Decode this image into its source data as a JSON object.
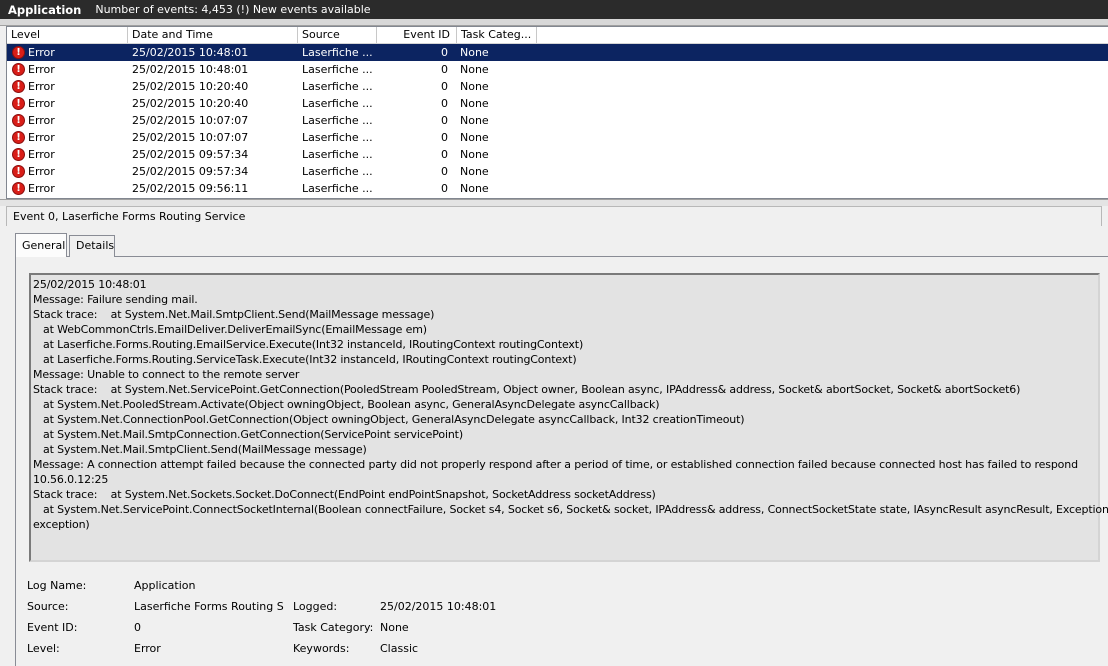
{
  "header": {
    "app_title": "Application",
    "event_count": "Number of events: 4,453 (!) New events available"
  },
  "columns": {
    "level": "Level",
    "datetime": "Date and Time",
    "source": "Source",
    "event_id": "Event ID",
    "task_category": "Task Categ..."
  },
  "events": [
    {
      "level": "Error",
      "datetime": "25/02/2015 10:48:01",
      "source": "Laserfiche ...",
      "event_id": "0",
      "task": "None"
    },
    {
      "level": "Error",
      "datetime": "25/02/2015 10:48:01",
      "source": "Laserfiche ...",
      "event_id": "0",
      "task": "None"
    },
    {
      "level": "Error",
      "datetime": "25/02/2015 10:20:40",
      "source": "Laserfiche ...",
      "event_id": "0",
      "task": "None"
    },
    {
      "level": "Error",
      "datetime": "25/02/2015 10:20:40",
      "source": "Laserfiche ...",
      "event_id": "0",
      "task": "None"
    },
    {
      "level": "Error",
      "datetime": "25/02/2015 10:07:07",
      "source": "Laserfiche ...",
      "event_id": "0",
      "task": "None"
    },
    {
      "level": "Error",
      "datetime": "25/02/2015 10:07:07",
      "source": "Laserfiche ...",
      "event_id": "0",
      "task": "None"
    },
    {
      "level": "Error",
      "datetime": "25/02/2015 09:57:34",
      "source": "Laserfiche ...",
      "event_id": "0",
      "task": "None"
    },
    {
      "level": "Error",
      "datetime": "25/02/2015 09:57:34",
      "source": "Laserfiche ...",
      "event_id": "0",
      "task": "None"
    },
    {
      "level": "Error",
      "datetime": "25/02/2015 09:56:11",
      "source": "Laserfiche ...",
      "event_id": "0",
      "task": "None"
    }
  ],
  "selected_row": 0,
  "detail": {
    "title": "Event 0, Laserfiche Forms Routing Service",
    "tabs": {
      "general": "General",
      "details": "Details"
    },
    "message_lines": [
      "25/02/2015 10:48:01",
      "Message: Failure sending mail.",
      "Stack trace:    at System.Net.Mail.SmtpClient.Send(MailMessage message)",
      "   at WebCommonCtrls.EmailDeliver.DeliverEmailSync(EmailMessage em)",
      "   at Laserfiche.Forms.Routing.EmailService.Execute(Int32 instanceId, IRoutingContext routingContext)",
      "   at Laserfiche.Forms.Routing.ServiceTask.Execute(Int32 instanceId, IRoutingContext routingContext)",
      "Message: Unable to connect to the remote server",
      "Stack trace:    at System.Net.ServicePoint.GetConnection(PooledStream PooledStream, Object owner, Boolean async, IPAddress& address, Socket& abortSocket, Socket& abortSocket6)",
      "   at System.Net.PooledStream.Activate(Object owningObject, Boolean async, GeneralAsyncDelegate asyncCallback)",
      "   at System.Net.ConnectionPool.GetConnection(Object owningObject, GeneralAsyncDelegate asyncCallback, Int32 creationTimeout)",
      "   at System.Net.Mail.SmtpConnection.GetConnection(ServicePoint servicePoint)",
      "   at System.Net.Mail.SmtpClient.Send(MailMessage message)",
      "Message: A connection attempt failed because the connected party did not properly respond after a period of time, or established connection failed because connected host has failed to respond",
      "10.56.0.12:25",
      "Stack trace:    at System.Net.Sockets.Socket.DoConnect(EndPoint endPointSnapshot, SocketAddress socketAddress)",
      "   at System.Net.ServicePoint.ConnectSocketInternal(Boolean connectFailure, Socket s4, Socket s6, Socket& socket, IPAddress& address, ConnectSocketState state, IAsyncResult asyncResult, Exception&",
      "exception)"
    ],
    "properties": {
      "log_name_label": "Log Name:",
      "log_name": "Application",
      "source_label": "Source:",
      "source": "Laserfiche Forms Routing Se",
      "logged_label": "Logged:",
      "logged": "25/02/2015 10:48:01",
      "event_id_label": "Event ID:",
      "event_id": "0",
      "task_category_label": "Task Category:",
      "task_category": "None",
      "level_label": "Level:",
      "level": "Error",
      "keywords_label": "Keywords:",
      "keywords": "Classic"
    }
  }
}
